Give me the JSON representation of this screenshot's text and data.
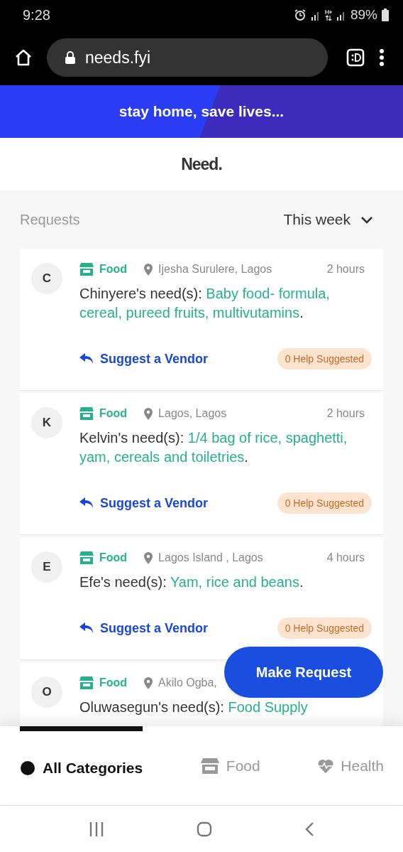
{
  "status_bar": {
    "time": "9:28",
    "battery": "89%"
  },
  "browser": {
    "url": "needs.fyi"
  },
  "banner": {
    "text": "stay home, save lives..."
  },
  "header": {
    "logo": "Need."
  },
  "filter": {
    "label": "Requests",
    "period": "This week"
  },
  "requests": [
    {
      "initial": "C",
      "category": "Food",
      "location": "Ijesha Surulere, Lagos",
      "time": "2 hours",
      "owner": "Chinyere's need(s):",
      "needs": "Baby food- formula, cereal, pureed fruits, multivutamins",
      "end": ".",
      "action": "Suggest a Vendor",
      "help": "0 Help Suggested"
    },
    {
      "initial": "K",
      "category": "Food",
      "location": "Lagos, Lagos",
      "time": "2 hours",
      "owner": "Kelvin's need(s):",
      "needs": "1/4 bag of rice, spaghetti, yam, cereals and toiletries",
      "end": ".",
      "action": "Suggest a Vendor",
      "help": "0 Help Suggested"
    },
    {
      "initial": "E",
      "category": "Food",
      "location": "Lagos Island , Lagos",
      "time": "4 hours",
      "owner": "Efe's need(s):",
      "needs": "Yam, rice and beans",
      "end": ".",
      "action": "Suggest a Vendor",
      "help": "0 Help Suggested"
    },
    {
      "initial": "O",
      "category": "Food",
      "location": "Akilo Ogba,",
      "owner": "Oluwasegun's need(s):",
      "needs": "Food Supply"
    }
  ],
  "make_request": "Make Request",
  "categories": [
    {
      "kind": "all",
      "label": "All Categories",
      "selected": true
    },
    {
      "kind": "food",
      "label": "Food",
      "selected": false
    },
    {
      "kind": "health",
      "label": "Health",
      "selected": false
    }
  ]
}
